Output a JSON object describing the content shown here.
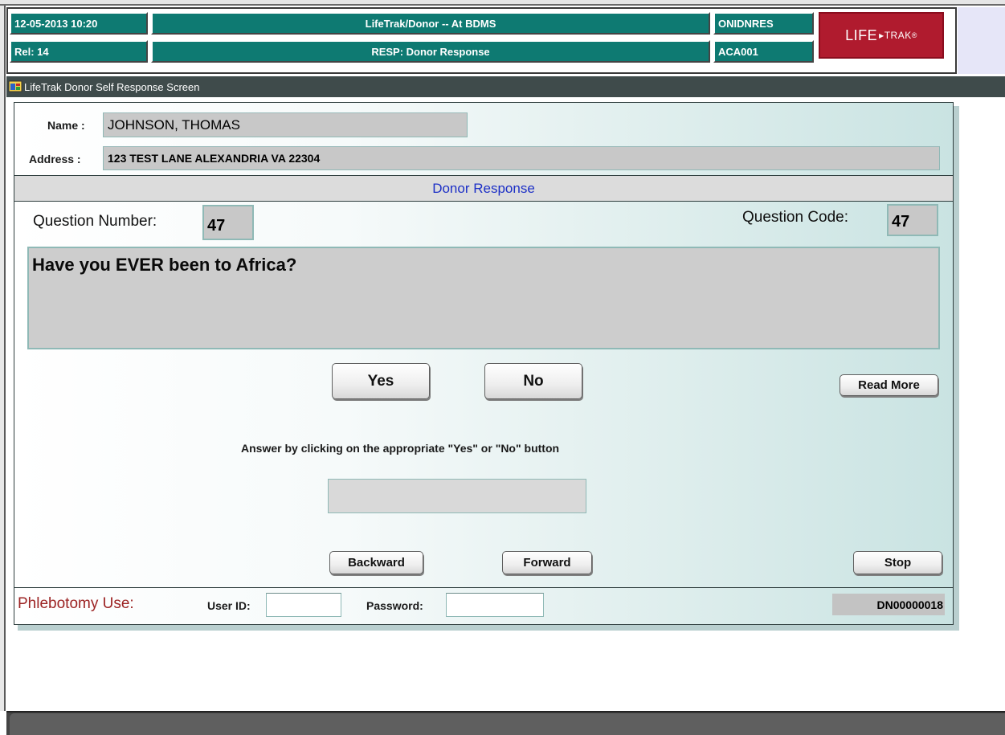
{
  "header": {
    "datetime": "12-05-2013  10:20",
    "release": "Rel: 14",
    "app_title": "LifeTrak/Donor -- At BDMS",
    "screen_title": "RESP: Donor Response",
    "code1": "ONIDNRES",
    "code2": "ACA001",
    "logo_text": "LIFE",
    "logo_trak": "▸TRAK",
    "logo_mark": "®"
  },
  "window": {
    "title": "LifeTrak Donor Self Response Screen",
    "icon": "app-window-icon"
  },
  "donor": {
    "name_label": "Name :",
    "name_value": "JOHNSON, THOMAS",
    "address_label": "Address :",
    "address_value": "123 TEST LANE  ALEXANDRIA VA 22304"
  },
  "section": {
    "title": "Donor Response"
  },
  "question": {
    "number_label": "Question Number:",
    "number_value": "47",
    "code_label": "Question Code:",
    "code_value": "47",
    "text": "Have you EVER been to Africa?"
  },
  "buttons": {
    "yes": "Yes",
    "no": "No",
    "read_more": "Read More",
    "backward": "Backward",
    "forward": "Forward",
    "stop": "Stop"
  },
  "instructions": "Answer by clicking on the appropriate \"Yes\"  or  \"No\" button",
  "answer_value": "",
  "phlebotomy": {
    "label": "Phlebotomy Use:",
    "user_id_label": "User ID:",
    "user_id_value": "",
    "password_label": "Password:",
    "password_value": "",
    "donor_id": "DN00000018"
  },
  "colors": {
    "header_teal": "#0e7a72",
    "logo_red": "#b01b2e",
    "section_text": "#1c2fc6",
    "phlebotomy_red": "#9c2323"
  }
}
